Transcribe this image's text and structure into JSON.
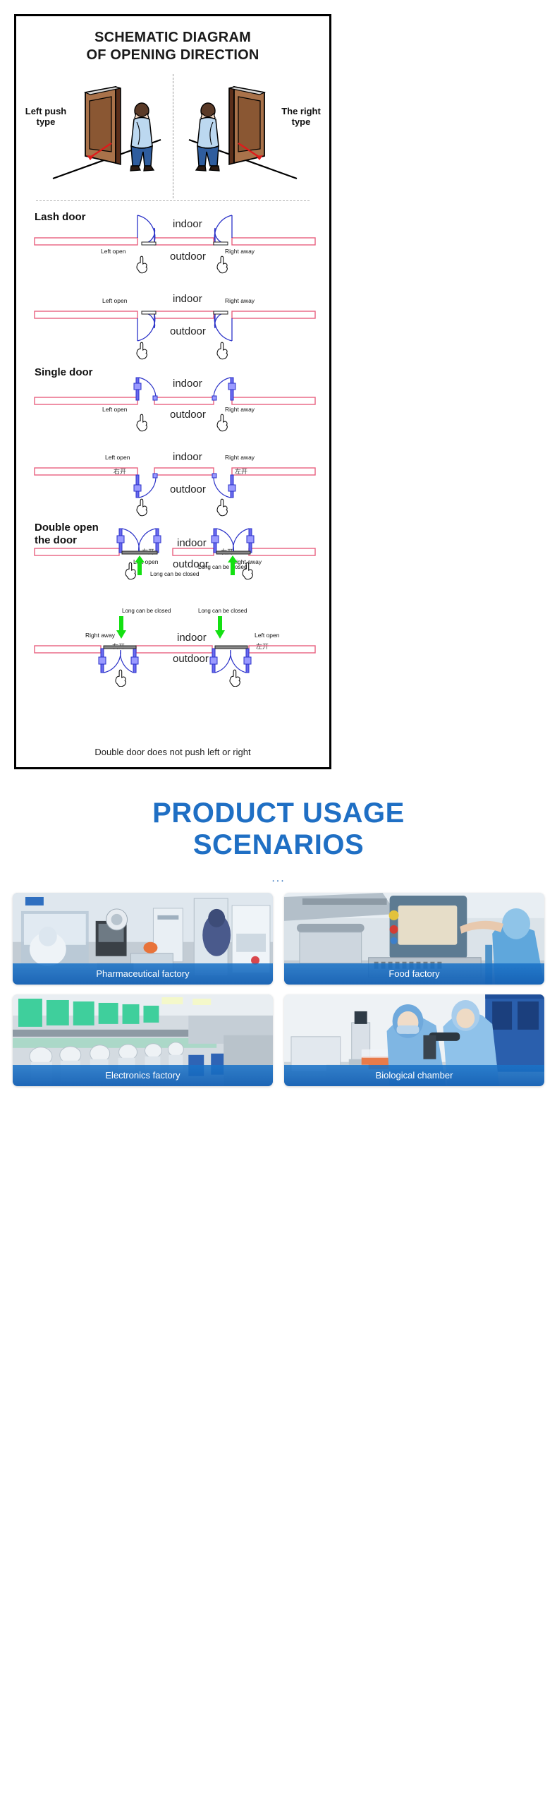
{
  "diagram": {
    "title_line1": "SCHEMATIC DIAGRAM",
    "title_line2": "OF OPENING DIRECTION",
    "perspective": {
      "left_label": "Left push\ntype",
      "right_label": "The right\ntype"
    },
    "labels": {
      "indoor": "indoor",
      "outdoor": "outdoor",
      "left_open": "Left open",
      "right_away": "Right away",
      "cn_left_open": "左开",
      "cn_right_open": "右开",
      "long_can_be_closed": "Long can be closed"
    },
    "sections": [
      {
        "name": "Lash door"
      },
      {
        "name": "Single door"
      },
      {
        "name": "Double open\nthe door"
      }
    ],
    "section_lash": "Lash door",
    "section_single": "Single door",
    "section_double_l1": "Double open",
    "section_double_l2": "the door",
    "bottom_note": "Double door does not push left or right"
  },
  "scenarios": {
    "title_line1": "PRODUCT USAGE",
    "title_line2": "SCENARIOS",
    "dots": "...",
    "accent_color": "#1f6fc4",
    "cards": [
      {
        "caption": "Pharmaceutical factory"
      },
      {
        "caption": "Food factory"
      },
      {
        "caption": "Electronics factory"
      },
      {
        "caption": "Biological chamber"
      }
    ]
  }
}
